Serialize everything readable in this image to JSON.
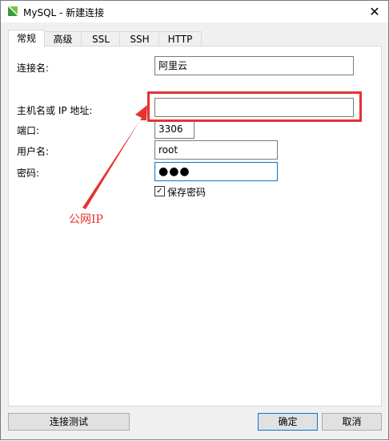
{
  "window": {
    "title": "MySQL - 新建连接",
    "close_glyph": "✕",
    "icon": "navicat-app-icon"
  },
  "tabs": [
    {
      "label": "常规",
      "active": true
    },
    {
      "label": "高级",
      "active": false
    },
    {
      "label": "SSL",
      "active": false
    },
    {
      "label": "SSH",
      "active": false
    },
    {
      "label": "HTTP",
      "active": false
    }
  ],
  "form": {
    "connection_name": {
      "label": "连接名:",
      "value": "阿里云"
    },
    "host": {
      "label": "主机名或 IP 地址:",
      "value": ""
    },
    "port": {
      "label": "端口:",
      "value": "3306"
    },
    "username": {
      "label": "用户名:",
      "value": "root"
    },
    "password": {
      "label": "密码:",
      "value": "●●●"
    },
    "save_password": {
      "label": "保存密码",
      "checked": true,
      "glyph": "✓"
    }
  },
  "annotation": {
    "text": "公网IP",
    "color": "#e53333"
  },
  "buttons": {
    "test": "连接测试",
    "ok": "确定",
    "cancel": "取消"
  }
}
